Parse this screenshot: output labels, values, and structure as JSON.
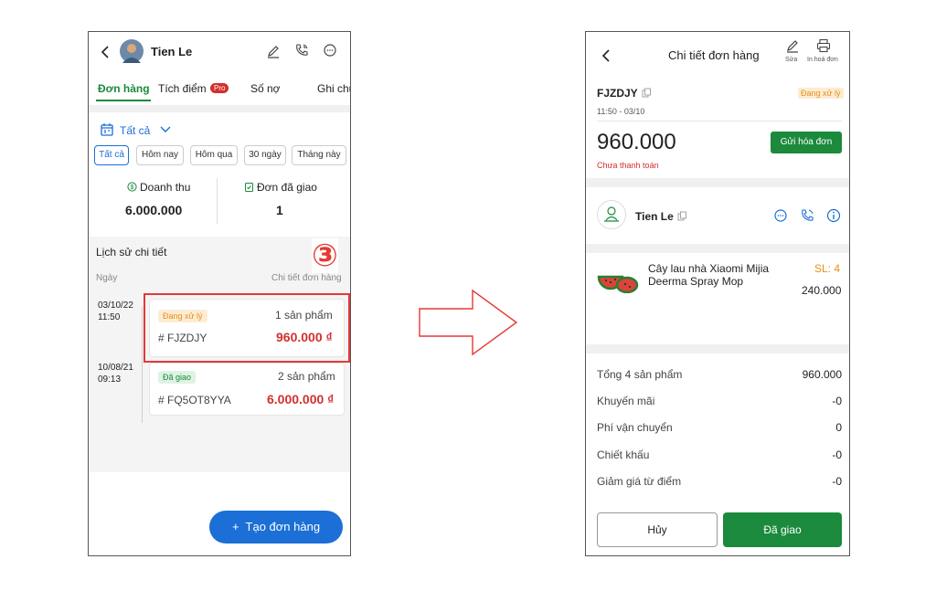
{
  "left": {
    "header": {
      "name": "Tien Le"
    },
    "tabs": [
      "Đơn hàng",
      "Tích điểm",
      "Số nợ",
      "Ghi chú"
    ],
    "pro_badge": "Pro",
    "filter": {
      "label": "Tất cả"
    },
    "pills": [
      "Tất cả",
      "Hôm nay",
      "Hôm qua",
      "30 ngày",
      "Tháng này"
    ],
    "stats": [
      {
        "label": "Doanh thu",
        "value": "6.000.000"
      },
      {
        "label": "Đơn đã giao",
        "value": "1"
      }
    ],
    "history": {
      "title": "Lịch sử chi tiết",
      "col_date": "Ngày",
      "col_detail": "Chi tiết đơn hàng",
      "step_marker": "③",
      "orders": [
        {
          "date": "03/10/22",
          "time": "11:50",
          "status": "Đang xử lý",
          "items": "1 sản phẩm",
          "code": "# FJZDJY",
          "amount": "960.000 ₫"
        },
        {
          "date": "10/08/21",
          "time": "09:13",
          "status": "Đã giao",
          "items": "2 sản phẩm",
          "code": "# FQ5OT8YYA",
          "amount": "6.000.000 ₫"
        }
      ]
    },
    "create_button": "+  Tạo đơn hàng"
  },
  "right": {
    "header": {
      "title": "Chi tiết đơn hàng",
      "edit_label": "Sửa",
      "print_label": "In hoá đơn"
    },
    "order": {
      "code": "FJZDJY",
      "status": "Đang xử lý",
      "datetime": "11:50 - 03/10",
      "total": "960.000",
      "payment_status": "Chưa thanh toán",
      "send_invoice": "Gửi hóa đơn"
    },
    "customer": {
      "name": "Tien Le"
    },
    "product": {
      "name": "Cây lau nhà Xiaomi Mijia Deerma Spray Mop",
      "qty": "SL: 4",
      "price": "240.000"
    },
    "summary": [
      {
        "label": "Tổng 4 sản phẩm",
        "value": "960.000"
      },
      {
        "label": "Khuyến mãi",
        "value": "-0"
      },
      {
        "label": "Phí vận chuyển",
        "value": "0"
      },
      {
        "label": "Chiết khấu",
        "value": "-0"
      },
      {
        "label": "Giảm giá từ điểm",
        "value": "-0"
      }
    ],
    "buttons": {
      "cancel": "Hủy",
      "delivered": "Đã giao"
    }
  },
  "colors": {
    "green": "#1b8a3c",
    "red": "#d32f2f",
    "blue": "#1b6fd6",
    "highlight": "#e53935",
    "orange": "#f5a623"
  }
}
